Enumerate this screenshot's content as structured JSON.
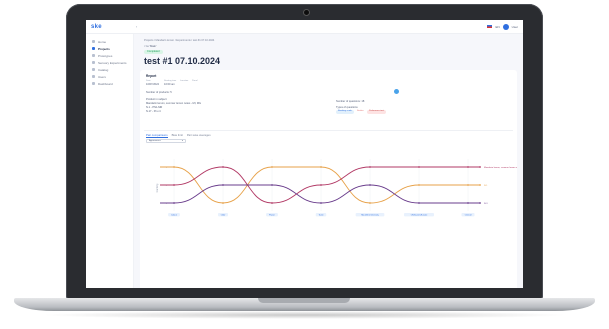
{
  "app": {
    "logo": "ske",
    "collapse_icon": "chevron-left-icon",
    "lang": "EN",
    "user": "User"
  },
  "sidebar": {
    "items": [
      {
        "label": "Home",
        "icon": "home-icon",
        "active": false
      },
      {
        "label": "Projects",
        "icon": "folder-icon",
        "active": true
      },
      {
        "label": "Prototypes",
        "icon": "cube-icon",
        "active": false
      },
      {
        "label": "Sensory Experiments",
        "icon": "flask-icon",
        "active": false
      },
      {
        "label": "Catalog",
        "icon": "book-icon",
        "active": false
      },
      {
        "label": "Users",
        "icon": "users-icon",
        "active": false
      },
      {
        "label": "Dashboard",
        "icon": "grid-icon",
        "active": false
      }
    ]
  },
  "page": {
    "breadcrumb": "Projects / Mandarin lemon / Experiments / test #1 07.10.2024",
    "back": "< to 'Main'",
    "status": "Completed",
    "title": "test #1 07.10.2024"
  },
  "report": {
    "heading": "Report",
    "fields": [
      {
        "label": "Date",
        "value": "10/07/2024"
      },
      {
        "label": "Starting time",
        "value": "10:00 am"
      },
      {
        "label": "Location",
        "value": ""
      },
      {
        "label": "Panel",
        "value": ""
      }
    ],
    "products_label": "Number of products: 5",
    "project_label": "Product in subject",
    "project_value": "Mandarin lemon, summer lemon notes - MI, MG",
    "lines": [
      "N.1 - PN1-MR",
      "N.17 - Pnu 4"
    ],
    "questions_label": "Number of questions: 18",
    "types_label": "Types of questions",
    "types": [
      "Ranking scale",
      "Scales",
      "Preference test"
    ]
  },
  "tabs": [
    "Pair comparisons",
    "Bias limit",
    "Pair-wise averages"
  ],
  "selector": {
    "value": "Appearance"
  },
  "chart_data": {
    "type": "line",
    "categories": [
      "Colour",
      "Odor",
      "Flavor",
      "Taste",
      "Mouthfeel intensity",
      "Off-flavor/off-taste",
      "Overall"
    ],
    "ylabel": "Ranking",
    "series": [
      {
        "name": "N.1",
        "color": "#e7a24a",
        "values": [
          1,
          3,
          1,
          1,
          3,
          2,
          2
        ]
      },
      {
        "name": "Mandarin lemon, summer lemon notes",
        "color": "#b23a66",
        "values": [
          2,
          1,
          3,
          2,
          1,
          1,
          1
        ]
      },
      {
        "name": "N.3",
        "color": "#6a3d8c",
        "values": [
          3,
          2,
          2,
          3,
          2,
          3,
          3
        ]
      }
    ],
    "right_labels": [
      "N.1",
      "Mandarin lemon, summer lemon notes",
      "N.3"
    ]
  }
}
